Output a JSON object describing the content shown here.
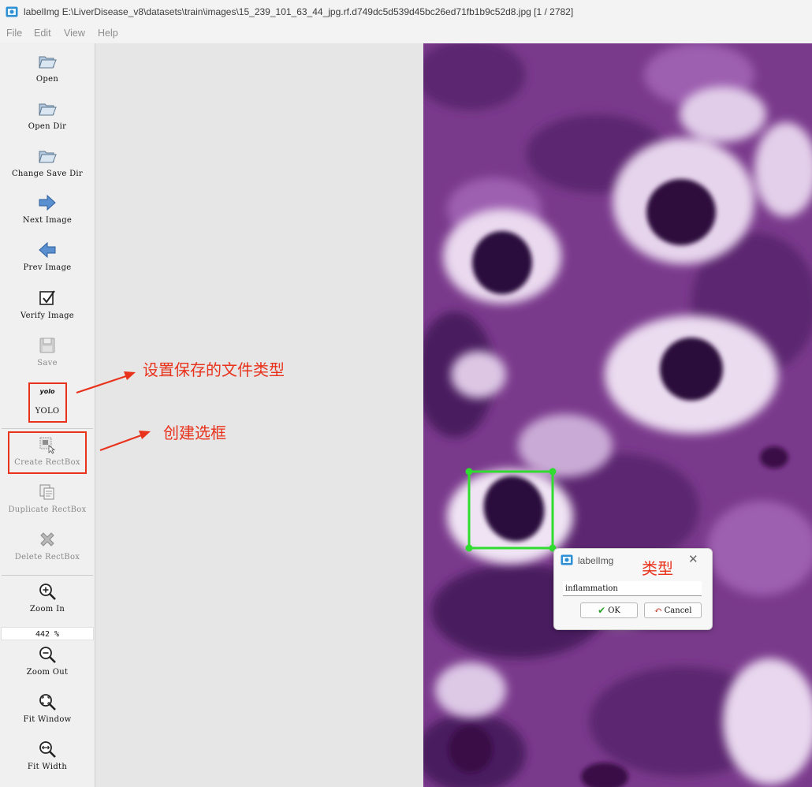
{
  "window": {
    "title": "labelImg E:\\LiverDisease_v8\\datasets\\train\\images\\15_239_101_63_44_jpg.rf.d749dc5d539d45bc26ed71fb1b9c52d8.jpg [1 / 2782]"
  },
  "menu": {
    "file": "File",
    "edit": "Edit",
    "view": "View",
    "help": "Help"
  },
  "toolbar": {
    "open": "Open",
    "open_dir": "Open Dir",
    "change_save_dir": "Change Save Dir",
    "next_image": "Next Image",
    "prev_image": "Prev Image",
    "verify_image": "Verify Image",
    "save": "Save",
    "format_icon_text": "yolo",
    "format": "YOLO",
    "create_rectbox": "Create RectBox",
    "duplicate_rectbox": "Duplicate RectBox",
    "delete_rectbox": "Delete RectBox",
    "zoom_in": "Zoom In",
    "zoom_value": "442 %",
    "zoom_out": "Zoom Out",
    "fit_window": "Fit Window",
    "fit_width": "Fit Width"
  },
  "annotations": {
    "save_format": "设置保存的文件类型",
    "create_box": "创建选框",
    "label_type": "类型"
  },
  "dialog": {
    "title": "labelImg",
    "input_value": "inflammation",
    "ok": "OK",
    "cancel": "Cancel"
  },
  "colors": {
    "annotation": "#e8321c",
    "bbox": "#2fdc2f",
    "tissue_dark": "#3a1046",
    "tissue_mid": "#7a3a8c",
    "tissue_light": "#e8dcef"
  }
}
